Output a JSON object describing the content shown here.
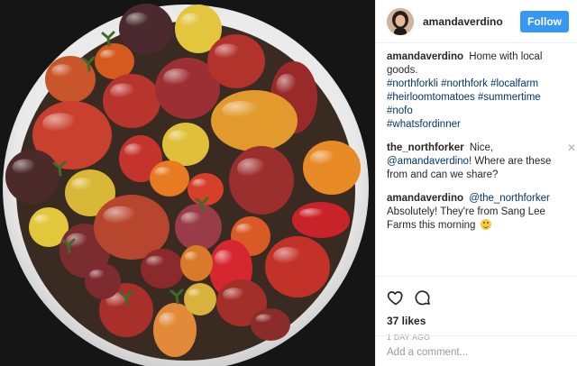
{
  "post": {
    "photo_alt": "",
    "header": {
      "username": "amandaverdino",
      "follow_label": "Follow"
    },
    "caption": {
      "author": "amandaverdino",
      "text": "Home with local goods.",
      "hashtags": [
        "#northforkli",
        "#northfork",
        "#localfarm",
        "#heirloomtomatoes",
        "#summertime",
        "#nofo",
        "#whatsfordinner"
      ]
    },
    "comments": [
      {
        "author": "the_northforker",
        "text_before": "Nice,",
        "mention": "@amandaverdino",
        "text_after": "! Where are these from and can we share?"
      },
      {
        "author": "amandaverdino",
        "mention": "@the_northforker",
        "text_after": "Absolutely! They're from Sang Lee Farms this morning"
      }
    ],
    "likes_text": "37 likes",
    "age_text": "1 DAY AGO",
    "add_comment_placeholder": "Add a comment..."
  },
  "icons": {
    "like": "heart-icon",
    "comment": "comment-bubble-icon",
    "close": "close-icon",
    "emoji": "smiling-face-icon"
  },
  "colors": {
    "follow_button": "#3897f0",
    "link": "#003569",
    "muted": "#999999"
  }
}
